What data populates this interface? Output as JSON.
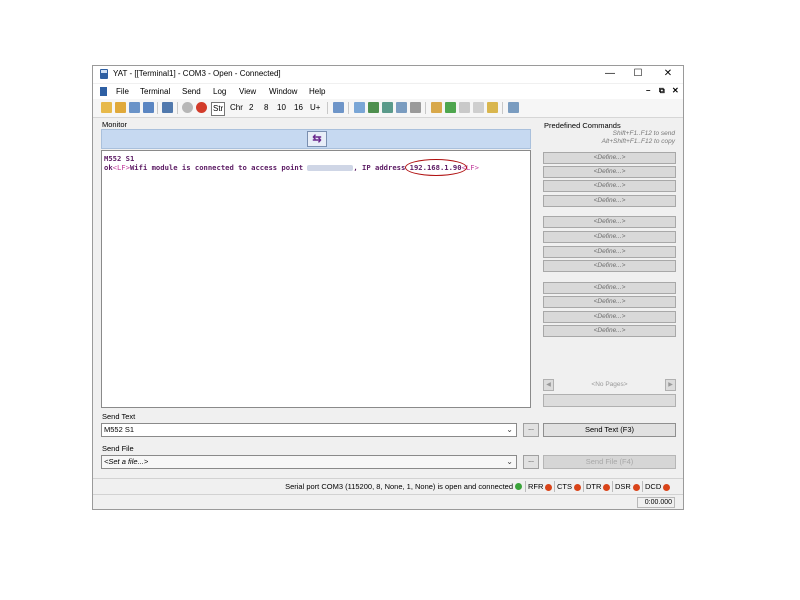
{
  "window": {
    "title": "YAT - [[Terminal1] - COM3 - Open - Connected]"
  },
  "menu": [
    "File",
    "Terminal",
    "Send",
    "Log",
    "View",
    "Window",
    "Help"
  ],
  "toolbar": {
    "text_buttons": [
      "Str",
      "Chr",
      "2",
      "8",
      "10",
      "16",
      "U+"
    ]
  },
  "monitor": {
    "label": "Monitor",
    "lines": [
      {
        "segments": [
          {
            "text": "M552 S1",
            "style": "purple"
          }
        ]
      }
    ],
    "line2": {
      "ok": "ok",
      "lf1": "<LF>",
      "msg": "Wifi module is connected to access point ",
      "ip_label": ", IP address ",
      "ip": "192.168.1.90",
      "lf2": "<LF>"
    }
  },
  "predefined": {
    "title": "Predefined Commands",
    "hint1": "Shift+F1..F12 to send",
    "hint2": "Alt+Shift+F1..F12 to copy",
    "define_label": "<Define...>",
    "no_pages": "<No Pages>"
  },
  "send_text": {
    "label": "Send Text",
    "value": "M552 S1",
    "button": "Send Text (F3)",
    "browse": "..."
  },
  "send_file": {
    "label": "Send File",
    "value": "<Set a file...>",
    "button": "Send File (F4)",
    "browse": "..."
  },
  "status": {
    "text": "Serial port COM3 (115200, 8, None, 1, None) is open and connected",
    "indicators": [
      {
        "label": "RFR",
        "color": "#d9441a"
      },
      {
        "label": "CTS",
        "color": "#d9441a"
      },
      {
        "label": "DTR",
        "color": "#d9441a"
      },
      {
        "label": "DSR",
        "color": "#d9441a"
      },
      {
        "label": "DCD",
        "color": "#d9441a"
      }
    ],
    "connected_color": "#3aa33a",
    "timer": "0:00.000"
  }
}
